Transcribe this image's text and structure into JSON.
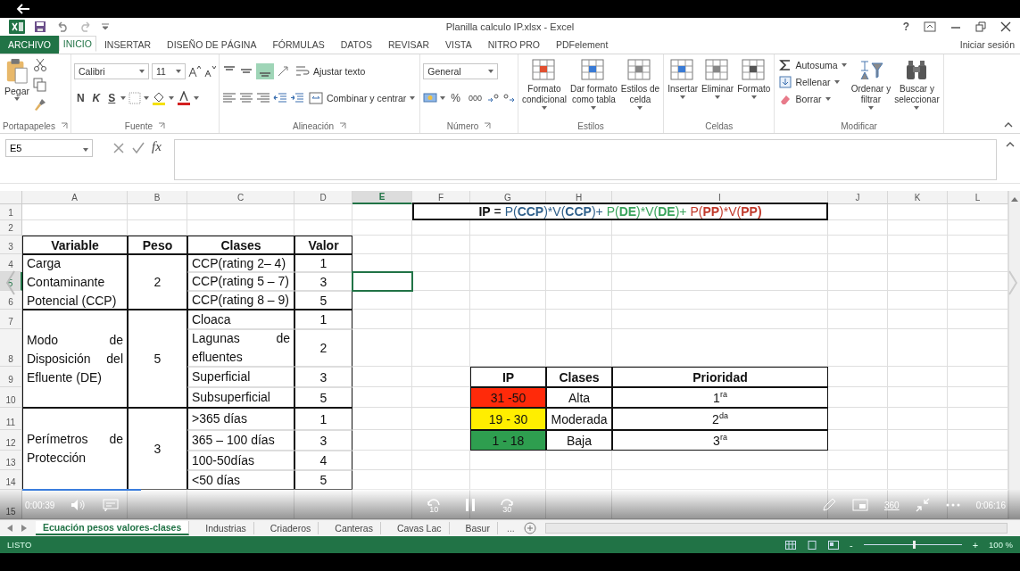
{
  "video": {
    "elapsed": "0:00:39",
    "total": "0:06:16",
    "progress": {
      "level": 0.12
    },
    "skip_back": "10",
    "skip_forward": "30",
    "badge_360": "360"
  },
  "window": {
    "title": "Planilla calculo IP.xlsx - Excel",
    "help": "?"
  },
  "ribbon_tabs": [
    {
      "label": "ARCHIVO",
      "kind": "file",
      "selected": false
    },
    {
      "label": "INICIO",
      "kind": "tab",
      "selected": true
    },
    {
      "label": "INSERTAR",
      "kind": "tab",
      "selected": false
    },
    {
      "label": "DISEÑO DE PÁGINA",
      "kind": "tab",
      "selected": false
    },
    {
      "label": "FÓRMULAS",
      "kind": "tab",
      "selected": false
    },
    {
      "label": "DATOS",
      "kind": "tab",
      "selected": false
    },
    {
      "label": "REVISAR",
      "kind": "tab",
      "selected": false
    },
    {
      "label": "VISTA",
      "kind": "tab",
      "selected": false
    },
    {
      "label": "NITRO PRO",
      "kind": "tab",
      "selected": false
    },
    {
      "label": "PDFelement",
      "kind": "tab",
      "selected": false
    }
  ],
  "sign_in": "Iniciar sesión",
  "ribbon_groups": [
    {
      "label": "Portapapeles",
      "kind": "clipboard",
      "paste": "Pegar"
    },
    {
      "label": "Fuente",
      "kind": "font",
      "font": "Calibri",
      "size": "11",
      "bold": "N",
      "italic": "K",
      "underline": "S"
    },
    {
      "label": "Alineación",
      "kind": "alignment",
      "wrap": "Ajustar texto",
      "merge": "Combinar y centrar"
    },
    {
      "label": "Número",
      "kind": "number",
      "format": "General",
      "percent": "%",
      "thousands": "000"
    },
    {
      "label": "Estilos",
      "kind": "large",
      "buttons": [
        "Formato\ncondicional",
        "Dar formato\ncomo tabla",
        "Estilos de\ncelda"
      ]
    },
    {
      "label": "Celdas",
      "kind": "large",
      "buttons": [
        "Insertar",
        "Eliminar",
        "Formato"
      ]
    },
    {
      "label": "Modificar",
      "kind": "edit",
      "small": [
        "Autosuma",
        "Rellenar",
        "Borrar"
      ],
      "buttons": [
        "Ordenar y\nfiltrar",
        "Buscar y\nseleccionar"
      ]
    }
  ],
  "formula_bar": {
    "name_box": "E5",
    "function_label": "fx"
  },
  "columns": [
    {
      "label": "A",
      "selected": false
    },
    {
      "label": "B",
      "selected": false
    },
    {
      "label": "C",
      "selected": false
    },
    {
      "label": "D",
      "selected": false
    },
    {
      "label": "E",
      "selected": true
    },
    {
      "label": "F",
      "selected": false
    },
    {
      "label": "G",
      "selected": false
    },
    {
      "label": "H",
      "selected": false
    },
    {
      "label": "I",
      "selected": false
    },
    {
      "label": "J",
      "selected": false
    },
    {
      "label": "K",
      "selected": false
    },
    {
      "label": "L",
      "selected": false
    }
  ],
  "rows": [
    {
      "label": "1",
      "selected": false
    },
    {
      "label": "2",
      "selected": false
    },
    {
      "label": "3",
      "selected": false
    },
    {
      "label": "4",
      "selected": false
    },
    {
      "label": "5",
      "selected": true
    },
    {
      "label": "6",
      "selected": false
    },
    {
      "label": "7",
      "selected": false
    },
    {
      "label": "8",
      "selected": false
    },
    {
      "label": "9",
      "selected": false
    },
    {
      "label": "10",
      "selected": false
    },
    {
      "label": "11",
      "selected": false
    },
    {
      "label": "12",
      "selected": false
    },
    {
      "label": "13",
      "selected": false
    },
    {
      "label": "14",
      "selected": false
    },
    {
      "label": "15",
      "selected": false
    }
  ],
  "formula": {
    "parts": [
      {
        "text": "IP",
        "color": "#111111",
        "bold": true
      },
      {
        "text": " = ",
        "color": "#111111",
        "bold": false
      },
      {
        "text": "P(",
        "color": "#2e5f8a",
        "bold": false
      },
      {
        "text": "CCP",
        "color": "#2e5f8a",
        "bold": true
      },
      {
        "text": ")*V(",
        "color": "#2e5f8a",
        "bold": false
      },
      {
        "text": "CCP",
        "color": "#2e5f8a",
        "bold": true
      },
      {
        "text": ")+ ",
        "color": "#2e5f8a",
        "bold": false
      },
      {
        "text": "P(",
        "color": "#3aa35c",
        "bold": false
      },
      {
        "text": "DE",
        "color": "#3aa35c",
        "bold": true
      },
      {
        "text": ")*V(",
        "color": "#3aa35c",
        "bold": false
      },
      {
        "text": "DE",
        "color": "#3aa35c",
        "bold": true
      },
      {
        "text": ")+ ",
        "color": "#3aa35c",
        "bold": false
      },
      {
        "text": "P(",
        "color": "#c0392b",
        "bold": false
      },
      {
        "text": "PP",
        "color": "#c0392b",
        "bold": true
      },
      {
        "text": ")*V(",
        "color": "#c0392b",
        "bold": false
      },
      {
        "text": "PP",
        "color": "#c0392b",
        "bold": true
      },
      {
        "text": ")",
        "color": "#c0392b",
        "bold": true
      }
    ]
  },
  "weights_table": {
    "columns": [
      "Variable",
      "Peso",
      "Clases",
      "Valor"
    ],
    "groups": [
      {
        "variable": "Carga Contaminante Potencial (CCP)",
        "weight": "2",
        "classes": [
          {
            "name": "CCP(rating 2– 4)",
            "value": "1"
          },
          {
            "name": "CCP(rating 5 – 7)",
            "value": "3"
          },
          {
            "name": "CCP(rating 8 – 9)",
            "value": "5"
          }
        ]
      },
      {
        "variable": "Modo de Disposición del Efluente (DE)",
        "weight": "5",
        "classes": [
          {
            "name": "Cloaca",
            "value": "1"
          },
          {
            "name": "Lagunas de efluentes",
            "value": "2"
          },
          {
            "name": "Superficial",
            "value": "3"
          },
          {
            "name": "Subsuperficial",
            "value": "5"
          }
        ]
      },
      {
        "variable": "Perímetros de Protección",
        "weight": "3",
        "classes": [
          {
            "name": ">365 días",
            "value": "1"
          },
          {
            "name": "365 – 100 días",
            "value": "3"
          },
          {
            "name": "100-50días",
            "value": "4"
          },
          {
            "name": "<50 días",
            "value": "5"
          }
        ]
      }
    ]
  },
  "priority_table": {
    "columns": [
      "IP",
      "Clases",
      "Prioridad"
    ],
    "rows": [
      {
        "ip": "31 -50",
        "color": "#ff2a0a",
        "class": "Alta",
        "priority": "1$^{ra}$"
      },
      {
        "ip": "19 - 30",
        "color": "#ffee00",
        "class": "Moderada",
        "priority": "2$^{da}$"
      },
      {
        "ip": "1 - 18",
        "color": "#2e9e4f",
        "class": "Baja",
        "priority": "3$^{ra}$"
      }
    ]
  },
  "sheet_tabs": [
    {
      "label": "Ecuación pesos valores-clases",
      "selected": true
    },
    {
      "label": "Industrias",
      "selected": false
    },
    {
      "label": "Criaderos",
      "selected": false
    },
    {
      "label": "Canteras",
      "selected": false
    },
    {
      "label": "Cavas Lac",
      "selected": false
    },
    {
      "label": "Basur",
      "selected": false
    }
  ],
  "more_tabs": "...",
  "status": {
    "text": "LISTO",
    "zoom_out": "-",
    "zoom_in": "+",
    "zoom": "100 %",
    "zoom_slider": {
      "level": 0.5
    }
  }
}
